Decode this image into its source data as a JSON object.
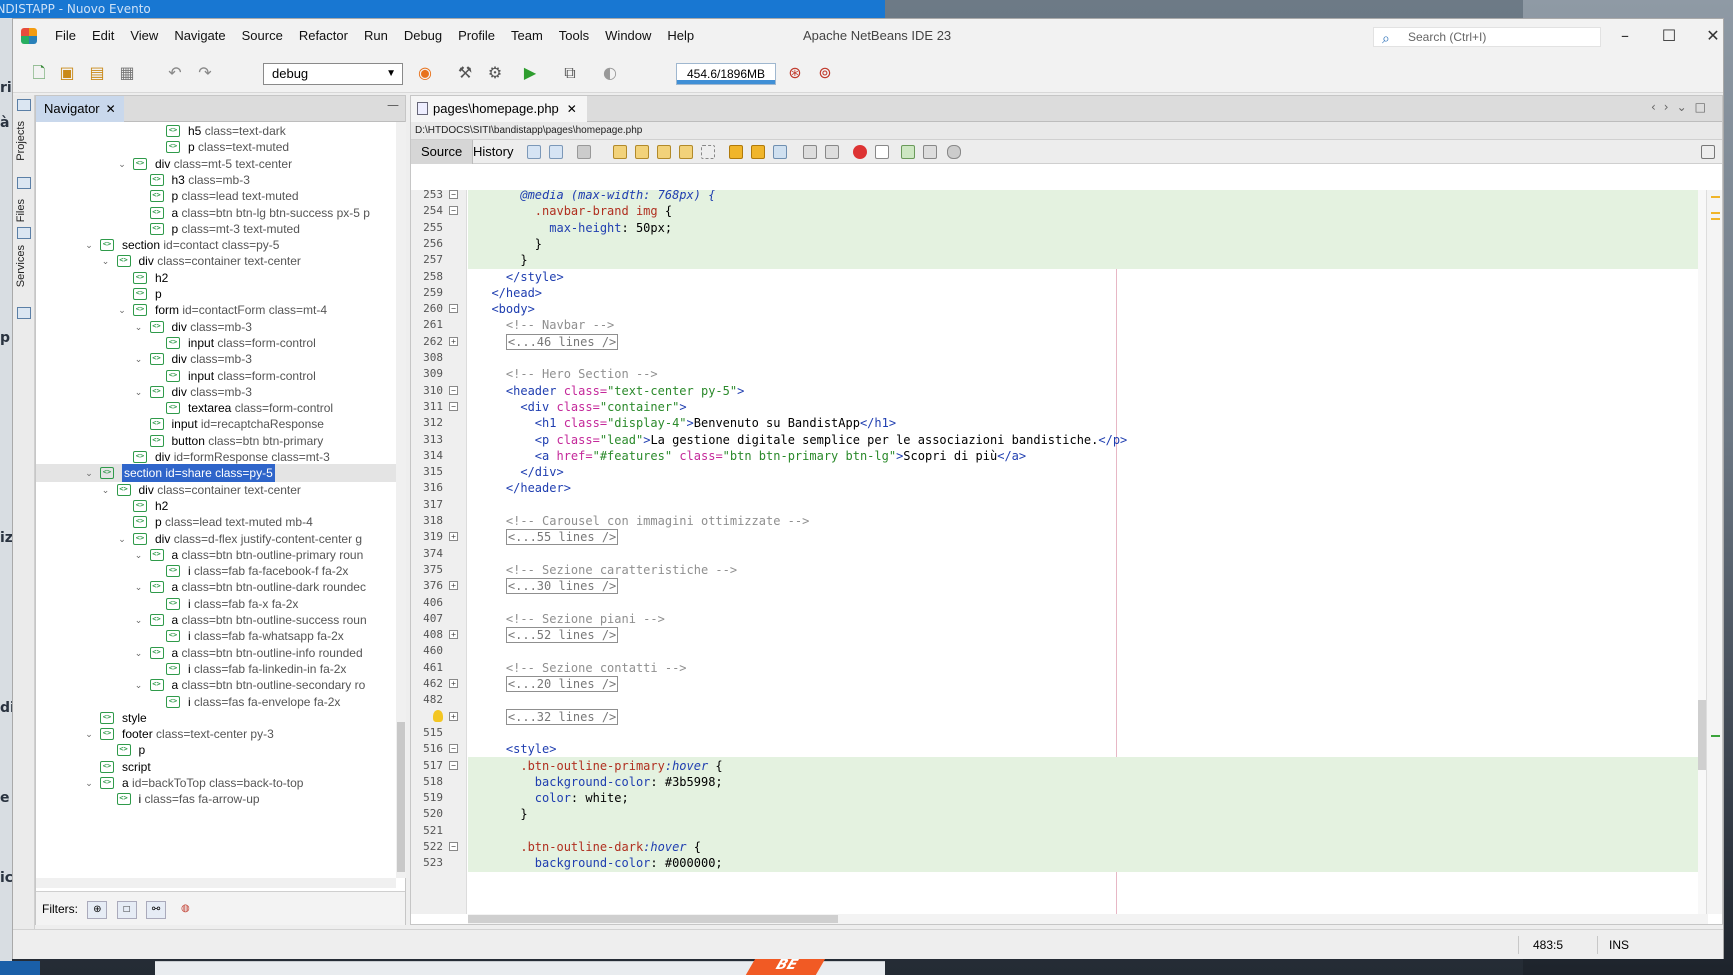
{
  "behind_window": {
    "title": "BANDISTAPP - Nuovo Evento"
  },
  "window": {
    "title": "Apache NetBeans IDE 23"
  },
  "menu": [
    "File",
    "Edit",
    "View",
    "Navigate",
    "Source",
    "Refactor",
    "Run",
    "Debug",
    "Profile",
    "Team",
    "Tools",
    "Window",
    "Help"
  ],
  "search": {
    "placeholder": "Search (Ctrl+I)"
  },
  "toolbar": {
    "config": "debug",
    "memory": "454.6/1896MB"
  },
  "side_tabs": [
    "Projects",
    "Files",
    "Services"
  ],
  "navigator": {
    "title": "Navigator",
    "filters_label": "Filters:",
    "rows": [
      {
        "depth": 8,
        "toggle": "",
        "tag": "h5",
        "attr": "class=text-dark"
      },
      {
        "depth": 8,
        "toggle": "",
        "tag": "p",
        "attr": "class=text-muted"
      },
      {
        "depth": 6,
        "toggle": "v",
        "tag": "div",
        "attr": "class=mt-5 text-center"
      },
      {
        "depth": 7,
        "toggle": "",
        "tag": "h3",
        "attr": "class=mb-3"
      },
      {
        "depth": 7,
        "toggle": "",
        "tag": "p",
        "attr": "class=lead text-muted"
      },
      {
        "depth": 7,
        "toggle": "",
        "tag": "a",
        "attr": "class=btn btn-lg btn-success px-5 p"
      },
      {
        "depth": 7,
        "toggle": "",
        "tag": "p",
        "attr": "class=mt-3 text-muted"
      },
      {
        "depth": 4,
        "toggle": "v",
        "tag": "section",
        "attr": "id=contact class=py-5"
      },
      {
        "depth": 5,
        "toggle": "v",
        "tag": "div",
        "attr": "class=container text-center"
      },
      {
        "depth": 6,
        "toggle": "",
        "tag": "h2",
        "attr": ""
      },
      {
        "depth": 6,
        "toggle": "",
        "tag": "p",
        "attr": ""
      },
      {
        "depth": 6,
        "toggle": "v",
        "tag": "form",
        "attr": "id=contactForm class=mt-4"
      },
      {
        "depth": 7,
        "toggle": "v",
        "tag": "div",
        "attr": "class=mb-3"
      },
      {
        "depth": 8,
        "toggle": "",
        "tag": "input",
        "attr": "class=form-control"
      },
      {
        "depth": 7,
        "toggle": "v",
        "tag": "div",
        "attr": "class=mb-3"
      },
      {
        "depth": 8,
        "toggle": "",
        "tag": "input",
        "attr": "class=form-control"
      },
      {
        "depth": 7,
        "toggle": "v",
        "tag": "div",
        "attr": "class=mb-3"
      },
      {
        "depth": 8,
        "toggle": "",
        "tag": "textarea",
        "attr": "class=form-control"
      },
      {
        "depth": 7,
        "toggle": "",
        "tag": "input",
        "attr": "id=recaptchaResponse"
      },
      {
        "depth": 7,
        "toggle": "",
        "tag": "button",
        "attr": "class=btn btn-primary"
      },
      {
        "depth": 6,
        "toggle": "",
        "tag": "div",
        "attr": "id=formResponse class=mt-3"
      },
      {
        "depth": 4,
        "toggle": "v",
        "tag": "section",
        "attr": "id=share class=py-5",
        "selected": true
      },
      {
        "depth": 5,
        "toggle": "v",
        "tag": "div",
        "attr": "class=container text-center"
      },
      {
        "depth": 6,
        "toggle": "",
        "tag": "h2",
        "attr": ""
      },
      {
        "depth": 6,
        "toggle": "",
        "tag": "p",
        "attr": "class=lead text-muted mb-4"
      },
      {
        "depth": 6,
        "toggle": "v",
        "tag": "div",
        "attr": "class=d-flex justify-content-center g"
      },
      {
        "depth": 7,
        "toggle": "v",
        "tag": "a",
        "attr": "class=btn btn-outline-primary roun"
      },
      {
        "depth": 8,
        "toggle": "",
        "tag": "i",
        "attr": "class=fab fa-facebook-f fa-2x"
      },
      {
        "depth": 7,
        "toggle": "v",
        "tag": "a",
        "attr": "class=btn btn-outline-dark roundec"
      },
      {
        "depth": 8,
        "toggle": "",
        "tag": "i",
        "attr": "class=fab fa-x fa-2x"
      },
      {
        "depth": 7,
        "toggle": "v",
        "tag": "a",
        "attr": "class=btn btn-outline-success roun"
      },
      {
        "depth": 8,
        "toggle": "",
        "tag": "i",
        "attr": "class=fab fa-whatsapp fa-2x"
      },
      {
        "depth": 7,
        "toggle": "v",
        "tag": "a",
        "attr": "class=btn btn-outline-info rounded"
      },
      {
        "depth": 8,
        "toggle": "",
        "tag": "i",
        "attr": "class=fab fa-linkedin-in fa-2x"
      },
      {
        "depth": 7,
        "toggle": "v",
        "tag": "a",
        "attr": "class=btn btn-outline-secondary ro"
      },
      {
        "depth": 8,
        "toggle": "",
        "tag": "i",
        "attr": "class=fas fa-envelope fa-2x"
      },
      {
        "depth": 4,
        "toggle": "",
        "tag": "style",
        "attr": ""
      },
      {
        "depth": 4,
        "toggle": "v",
        "tag": "footer",
        "attr": "class=text-center py-3"
      },
      {
        "depth": 5,
        "toggle": "",
        "tag": "p",
        "attr": ""
      },
      {
        "depth": 4,
        "toggle": "",
        "tag": "script",
        "attr": ""
      },
      {
        "depth": 4,
        "toggle": "v",
        "tag": "a",
        "attr": "id=backToTop class=back-to-top"
      },
      {
        "depth": 5,
        "toggle": "",
        "tag": "i",
        "attr": "class=fas fa-arrow-up"
      }
    ]
  },
  "editor": {
    "tab": "pages\\homepage.php",
    "path": "D:\\HTDOCS\\SITI\\bandistapp\\pages\\homepage.php",
    "tabs": [
      "Source",
      "History"
    ],
    "lines": [
      {
        "n": "253",
        "hl": true,
        "fold": "-",
        "segs": [
          [
            "k-it",
            "      @media (max-width: 768px) {"
          ]
        ]
      },
      {
        "n": "254",
        "hl": true,
        "fold": "-",
        "segs": [
          [
            "k-css",
            "        .navbar-brand img"
          ],
          [
            "k-plain",
            " {"
          ]
        ]
      },
      {
        "n": "255",
        "hl": true,
        "fold": "",
        "segs": [
          [
            "k-prop",
            "          max-height"
          ],
          [
            "k-plain",
            ": 50px;"
          ]
        ]
      },
      {
        "n": "256",
        "hl": true,
        "fold": "",
        "segs": [
          [
            "k-plain",
            "        }"
          ]
        ]
      },
      {
        "n": "257",
        "hl": true,
        "fold": "",
        "segs": [
          [
            "k-plain",
            "      }"
          ]
        ]
      },
      {
        "n": "258",
        "hl": false,
        "fold": "",
        "segs": [
          [
            "k-tag",
            "    </style>"
          ]
        ]
      },
      {
        "n": "259",
        "hl": false,
        "fold": "",
        "segs": [
          [
            "k-tag",
            "  </head>"
          ]
        ]
      },
      {
        "n": "260",
        "hl": false,
        "fold": "-",
        "segs": [
          [
            "k-tag",
            "  <body>"
          ]
        ]
      },
      {
        "n": "261",
        "hl": false,
        "fold": "",
        "segs": [
          [
            "k-com",
            "    <!-- Navbar -->"
          ]
        ]
      },
      {
        "n": "262",
        "hl": false,
        "fold": "+",
        "segs": [
          [
            "k-plain",
            "    "
          ],
          [
            "k-fold",
            "<...46 lines />"
          ]
        ]
      },
      {
        "n": "308",
        "hl": false,
        "fold": "",
        "segs": []
      },
      {
        "n": "309",
        "hl": false,
        "fold": "",
        "segs": [
          [
            "k-com",
            "    <!-- Hero Section -->"
          ]
        ]
      },
      {
        "n": "310",
        "hl": false,
        "fold": "-",
        "segs": [
          [
            "k-tag",
            "    <header "
          ],
          [
            "k-attr",
            "class="
          ],
          [
            "k-str",
            "\"text-center py-5\""
          ],
          [
            "k-tag",
            ">"
          ]
        ]
      },
      {
        "n": "311",
        "hl": false,
        "fold": "-",
        "segs": [
          [
            "k-tag",
            "      <div "
          ],
          [
            "k-attr",
            "class="
          ],
          [
            "k-str",
            "\"container\""
          ],
          [
            "k-tag",
            ">"
          ]
        ]
      },
      {
        "n": "312",
        "hl": false,
        "fold": "",
        "segs": [
          [
            "k-tag",
            "        <h1 "
          ],
          [
            "k-attr",
            "class="
          ],
          [
            "k-str",
            "\"display-4\""
          ],
          [
            "k-tag",
            ">"
          ],
          [
            "k-plain",
            "Benvenuto su BandistApp"
          ],
          [
            "k-tag",
            "</h1>"
          ]
        ]
      },
      {
        "n": "313",
        "hl": false,
        "fold": "",
        "segs": [
          [
            "k-tag",
            "        <p "
          ],
          [
            "k-attr",
            "class="
          ],
          [
            "k-str",
            "\"lead\""
          ],
          [
            "k-tag",
            ">"
          ],
          [
            "k-plain",
            "La gestione digitale semplice per le associazioni bandistiche."
          ],
          [
            "k-tag",
            "</p>"
          ]
        ]
      },
      {
        "n": "314",
        "hl": false,
        "fold": "",
        "segs": [
          [
            "k-tag",
            "        <a "
          ],
          [
            "k-attr",
            "href="
          ],
          [
            "k-str",
            "\"#features\""
          ],
          [
            "k-attr",
            " class="
          ],
          [
            "k-str",
            "\"btn btn-primary btn-lg\""
          ],
          [
            "k-tag",
            ">"
          ],
          [
            "k-plain",
            "Scopri di più"
          ],
          [
            "k-tag",
            "</a>"
          ]
        ]
      },
      {
        "n": "315",
        "hl": false,
        "fold": "",
        "segs": [
          [
            "k-tag",
            "      </div>"
          ]
        ]
      },
      {
        "n": "316",
        "hl": false,
        "fold": "",
        "segs": [
          [
            "k-tag",
            "    </header>"
          ]
        ]
      },
      {
        "n": "317",
        "hl": false,
        "fold": "",
        "segs": []
      },
      {
        "n": "318",
        "hl": false,
        "fold": "",
        "segs": [
          [
            "k-com",
            "    <!-- Carousel con immagini ottimizzate -->"
          ]
        ]
      },
      {
        "n": "319",
        "hl": false,
        "fold": "+",
        "segs": [
          [
            "k-plain",
            "    "
          ],
          [
            "k-fold",
            "<...55 lines />"
          ]
        ]
      },
      {
        "n": "374",
        "hl": false,
        "fold": "",
        "segs": []
      },
      {
        "n": "375",
        "hl": false,
        "fold": "",
        "segs": [
          [
            "k-com",
            "    <!-- Sezione caratteristiche -->"
          ]
        ]
      },
      {
        "n": "376",
        "hl": false,
        "fold": "+",
        "segs": [
          [
            "k-plain",
            "    "
          ],
          [
            "k-fold",
            "<...30 lines />"
          ]
        ]
      },
      {
        "n": "406",
        "hl": false,
        "fold": "",
        "segs": []
      },
      {
        "n": "407",
        "hl": false,
        "fold": "",
        "segs": [
          [
            "k-com",
            "    <!-- Sezione piani -->"
          ]
        ]
      },
      {
        "n": "408",
        "hl": false,
        "fold": "+",
        "segs": [
          [
            "k-plain",
            "    "
          ],
          [
            "k-fold",
            "<...52 lines />"
          ]
        ]
      },
      {
        "n": "460",
        "hl": false,
        "fold": "",
        "segs": []
      },
      {
        "n": "461",
        "hl": false,
        "fold": "",
        "segs": [
          [
            "k-com",
            "    <!-- Sezione contatti -->"
          ]
        ]
      },
      {
        "n": "462",
        "hl": false,
        "fold": "+",
        "segs": [
          [
            "k-plain",
            "    "
          ],
          [
            "k-fold",
            "<...20 lines />"
          ]
        ]
      },
      {
        "n": "482",
        "hl": false,
        "fold": "",
        "segs": []
      },
      {
        "n": "",
        "hl": false,
        "fold": "+",
        "bulb": true,
        "segs": [
          [
            "k-plain",
            "    "
          ],
          [
            "k-fold",
            "<...32 lines />"
          ]
        ]
      },
      {
        "n": "515",
        "hl": false,
        "fold": "",
        "segs": []
      },
      {
        "n": "516",
        "hl": false,
        "fold": "-",
        "segs": [
          [
            "k-tag",
            "    <style>"
          ]
        ]
      },
      {
        "n": "517",
        "hl": true,
        "fold": "-",
        "segs": [
          [
            "k-css",
            "      .btn-outline-primary"
          ],
          [
            "k-it",
            ":hover"
          ],
          [
            "k-plain",
            " {"
          ]
        ]
      },
      {
        "n": "518",
        "hl": true,
        "fold": "",
        "segs": [
          [
            "k-prop",
            "        background-color"
          ],
          [
            "k-plain",
            ": #3b5998;"
          ]
        ]
      },
      {
        "n": "519",
        "hl": true,
        "fold": "",
        "segs": [
          [
            "k-prop",
            "        color"
          ],
          [
            "k-plain",
            ": white;"
          ]
        ]
      },
      {
        "n": "520",
        "hl": true,
        "fold": "",
        "segs": [
          [
            "k-plain",
            "      }"
          ]
        ]
      },
      {
        "n": "521",
        "hl": true,
        "fold": "",
        "segs": []
      },
      {
        "n": "522",
        "hl": true,
        "fold": "-",
        "segs": [
          [
            "k-css",
            "      .btn-outline-dark"
          ],
          [
            "k-it",
            ":hover"
          ],
          [
            "k-plain",
            " {"
          ]
        ]
      },
      {
        "n": "523",
        "hl": true,
        "fold": "",
        "segs": [
          [
            "k-prop",
            "        background-color"
          ],
          [
            "k-plain",
            ": #000000;"
          ]
        ]
      }
    ]
  },
  "status": {
    "position": "483:5",
    "mode": "INS"
  },
  "colors": {
    "selection": "#2f65ca",
    "highlight": "#e4f2e0",
    "tag_icon": "#2f9a4a"
  }
}
